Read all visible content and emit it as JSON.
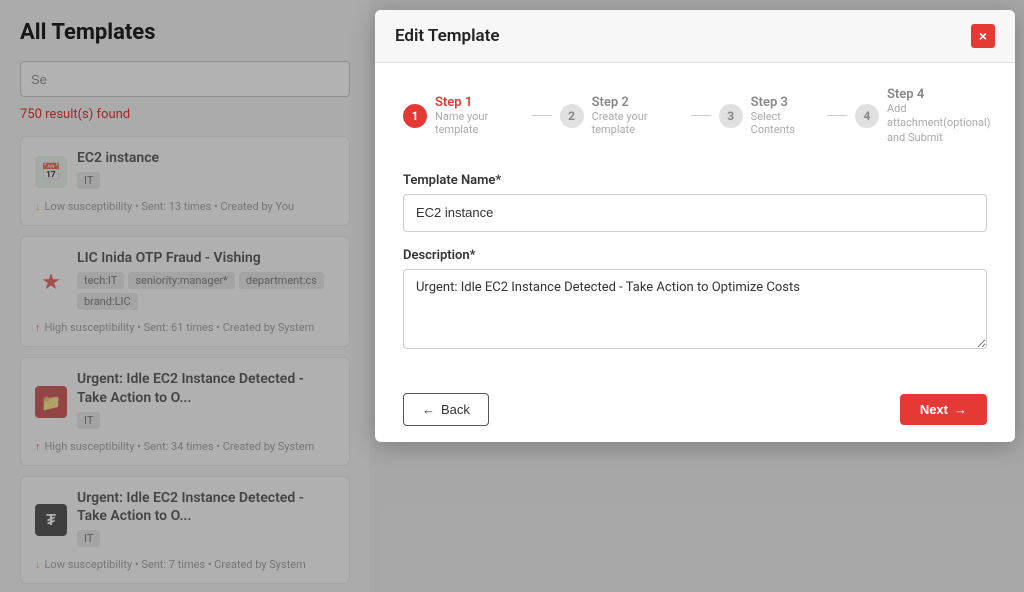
{
  "background": {
    "page_title": "All Templates",
    "search_placeholder": "Se",
    "results_count": "750 result(s) found",
    "templates": [
      {
        "name": "EC2 instance",
        "icon_type": "calendar",
        "icon_emoji": "📅",
        "icon_class": "icon-green",
        "tags": [
          "IT"
        ],
        "meta": "Low susceptibility • Sent: 13 times • Created by You",
        "meta_arrow": "down"
      },
      {
        "name": "LIC Inida OTP Fraud - Vishing",
        "icon_type": "star",
        "icon_emoji": "★",
        "icon_class": "icon-red-star",
        "tags": [
          "tech:IT",
          "seniority:manager*",
          "department:cs",
          "brand:LIC"
        ],
        "meta": "High susceptibility • Sent: 61 times • Created by System",
        "meta_arrow": "up"
      },
      {
        "name": "Urgent: Idle EC2 Instance Detected - Take Action to O...",
        "icon_type": "folder",
        "icon_emoji": "📁",
        "icon_class": "icon-dark-red",
        "tags": [
          "IT"
        ],
        "meta": "High susceptibility • Sent: 34 times • Created by System",
        "meta_arrow": "up"
      },
      {
        "name": "Urgent: Idle EC2 Instance Detected - Take Action to O...",
        "icon_type": "dollar",
        "icon_emoji": "₮",
        "icon_class": "icon-dark-folder",
        "tags": [
          "IT"
        ],
        "meta": "Low susceptibility • Sent: 7 times • Created by System",
        "meta_arrow": "down"
      }
    ]
  },
  "modal": {
    "title": "Edit Template",
    "close_label": "×",
    "steps": [
      {
        "number": "1",
        "label": "Step 1",
        "sublabel": "Name your template",
        "active": true
      },
      {
        "number": "2",
        "label": "Step 2",
        "sublabel": "Create your template",
        "active": false
      },
      {
        "number": "3",
        "label": "Step 3",
        "sublabel": "Select Contents",
        "active": false
      },
      {
        "number": "4",
        "label": "Step 4",
        "sublabel": "Add attachment(optional) and Submit",
        "active": false
      }
    ],
    "form": {
      "template_name_label": "Template Name*",
      "template_name_value": "EC2 instance",
      "description_label": "Description*",
      "description_value": "Urgent: Idle EC2 Instance Detected - Take Action to Optimize Costs"
    },
    "back_button": "← Back",
    "next_button": "Next →"
  }
}
